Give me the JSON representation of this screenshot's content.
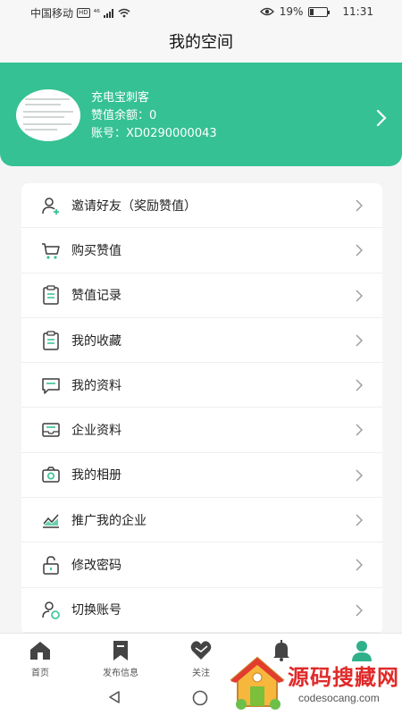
{
  "status_bar": {
    "carrier": "中国移动",
    "hd": "HD",
    "signal": "⁴⁶",
    "battery_percent": "19%",
    "battery_level": 0.19,
    "time": "11:31"
  },
  "header": {
    "title": "我的空间"
  },
  "profile": {
    "name": "充电宝刺客",
    "balance": "赞值余额：0",
    "account": "账号：XD0290000043"
  },
  "menu": [
    {
      "label": "邀请好友（奖励赞值）",
      "icon": "add-user-icon"
    },
    {
      "label": "购买赞值",
      "icon": "cart-icon"
    },
    {
      "label": "赞值记录",
      "icon": "clipboard-icon"
    },
    {
      "label": "我的收藏",
      "icon": "clipboard-icon"
    },
    {
      "label": "我的资料",
      "icon": "message-icon"
    },
    {
      "label": "企业资料",
      "icon": "envelope-icon"
    },
    {
      "label": "我的相册",
      "icon": "camera-icon"
    },
    {
      "label": "推广我的企业",
      "icon": "chart-icon"
    },
    {
      "label": "修改密码",
      "icon": "unlock-icon"
    },
    {
      "label": "切换账号",
      "icon": "switch-user-icon"
    }
  ],
  "bottom_nav": [
    {
      "label": "首页",
      "icon": "home-icon"
    },
    {
      "label": "发布信息",
      "icon": "bookmark-icon"
    },
    {
      "label": "关注",
      "icon": "heart-icon"
    },
    {
      "label": "",
      "icon": "bell-icon"
    },
    {
      "label": "",
      "icon": "user-icon",
      "active": true
    }
  ],
  "watermark": {
    "text": "源码搜藏网",
    "sub": "codesocang.com"
  },
  "colors": {
    "accent": "#35c193",
    "icon_dark": "#3c3c3c",
    "active_nav": "#2fb08a"
  }
}
